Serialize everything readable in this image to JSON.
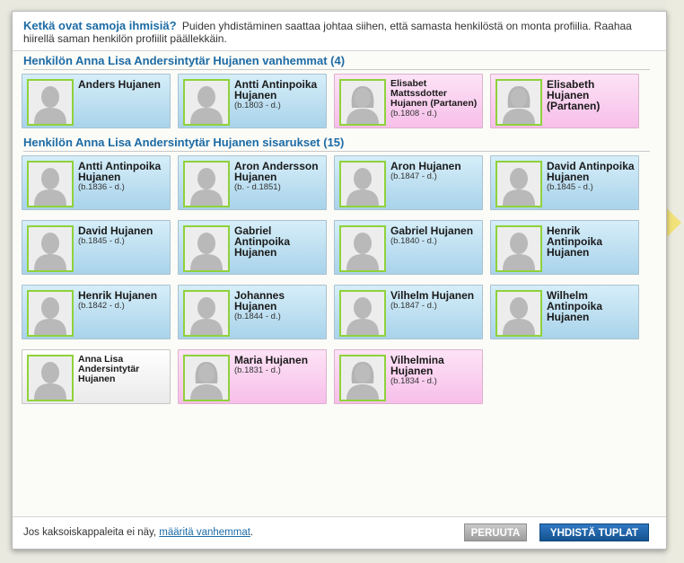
{
  "header": {
    "question": "Ketkä ovat samoja ihmisiä?",
    "text": "Puiden yhdistäminen saattaa johtaa siihen, että samasta henkilöstä on monta profiilia. Raahaa hiirellä saman henkilön profiilit päällekkäin."
  },
  "parents": {
    "title": "Henkilön Anna Lisa Andersintytär Hujanen vanhemmat (4)",
    "people": [
      {
        "name": "Anders Hujanen",
        "dates": "",
        "gender": "male"
      },
      {
        "name": "Antti Antinpoika Hujanen",
        "dates": "(b.1803 - d.)",
        "gender": "male"
      },
      {
        "name": "Elisabet Mattssdotter Hujanen (Partanen)",
        "dates": "(b.1808 - d.)",
        "gender": "female"
      },
      {
        "name": "Elisabeth Hujanen (Partanen)",
        "dates": "",
        "gender": "female"
      }
    ]
  },
  "siblings": {
    "title": "Henkilön Anna Lisa Andersintytär Hujanen sisarukset (15)",
    "people": [
      {
        "name": "Antti Antinpoika Hujanen",
        "dates": "(b.1836 - d.)",
        "gender": "male"
      },
      {
        "name": "Aron Andersson Hujanen",
        "dates": "(b. - d.1851)",
        "gender": "male"
      },
      {
        "name": "Aron Hujanen",
        "dates": "(b.1847 - d.)",
        "gender": "male"
      },
      {
        "name": "David Antinpoika Hujanen",
        "dates": "(b.1845 - d.)",
        "gender": "male"
      },
      {
        "name": "David Hujanen",
        "dates": "(b.1845 - d.)",
        "gender": "male"
      },
      {
        "name": "Gabriel Antinpoika Hujanen",
        "dates": "",
        "gender": "male"
      },
      {
        "name": "Gabriel Hujanen",
        "dates": "(b.1840 - d.)",
        "gender": "male"
      },
      {
        "name": "Henrik Antinpoika Hujanen",
        "dates": "",
        "gender": "male"
      },
      {
        "name": "Henrik Hujanen",
        "dates": "(b.1842 - d.)",
        "gender": "male"
      },
      {
        "name": "Johannes Hujanen",
        "dates": "(b.1844 - d.)",
        "gender": "male"
      },
      {
        "name": "Vilhelm Hujanen",
        "dates": "(b.1847 - d.)",
        "gender": "male"
      },
      {
        "name": "Wilhelm Antinpoika Hujanen",
        "dates": "",
        "gender": "male"
      },
      {
        "name": "Anna Lisa Andersintytär Hujanen",
        "dates": "",
        "gender": "self"
      },
      {
        "name": "Maria Hujanen",
        "dates": "(b.1831 - d.)",
        "gender": "female"
      },
      {
        "name": "Vilhelmina Hujanen",
        "dates": "(b.1834 - d.)",
        "gender": "female"
      }
    ]
  },
  "footer": {
    "note_prefix": "Jos kaksoiskappaleita ei näy,",
    "note_link": "määritä vanhemmat",
    "note_suffix": ".",
    "cancel_label": "PERUUTA",
    "merge_label": "YHDISTÄ TUPLAT"
  },
  "colors": {
    "accent": "#1c6ba5",
    "male_card": "#bfe1f2",
    "female_card": "#fbd0f0",
    "photo_border": "#8fd23a",
    "merge_button": "#1f63a8"
  }
}
